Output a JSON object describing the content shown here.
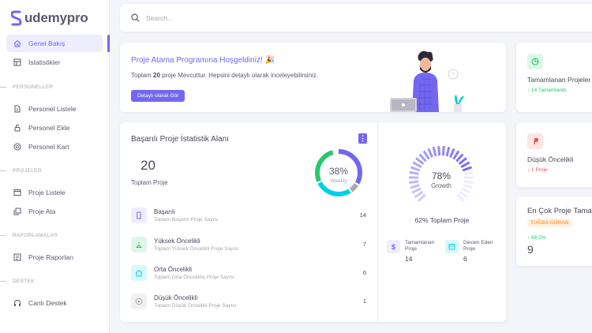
{
  "app": {
    "logo_text": "udemypro"
  },
  "sidebar": {
    "items": {
      "genel": "Genel Bakış",
      "istatistikler": "İstatistikler",
      "personel_listele": "Personel Listele",
      "personel_ekle": "Personel Ekle",
      "personel_kart": "Personel Kart",
      "proje_listele": "Proje Listele",
      "proje_ata": "Proje Ata",
      "proje_raporlari": "Proje Raporları",
      "canli_destek": "Canlı Destek"
    },
    "sections": {
      "personeller": "PERSONELLER",
      "projeler": "PROJELER",
      "raporlamalar": "RAPORLAMALAR",
      "destek": "DESTEK"
    }
  },
  "search": {
    "placeholder": "Search..."
  },
  "welcome": {
    "title": "Proje Atama Programına Hoşgeldiniz! 🎉",
    "text_prefix": "Toplam ",
    "count": "20",
    "text_suffix": " proje Mevcuttur. Hepsini detaylı olarak inceleyebilirsiniz.",
    "button": "Detaylı olarak Gör"
  },
  "right_cards": {
    "completed": {
      "title": "Tamamlanan Projeler",
      "sub": "↑ 14 Tamamlandı",
      "sub_color": "#28c76f"
    },
    "low_priority": {
      "title": "Düşük Öncelikli",
      "sub": "↓ 1 Proje",
      "sub_color": "#ea5455"
    },
    "top": {
      "title": "En Çok Proje Tamamlayan",
      "badge": "TUĞBA GÜRAN",
      "pct": "↑ 68.2%",
      "value": "9"
    }
  },
  "stats": {
    "title": "Başarılı Proje İstatistik Alanı",
    "menu": "⋮",
    "total_value": "20",
    "total_label": "Toplam Proje",
    "donut_value": "38%",
    "donut_label": "Weekly",
    "rows": [
      {
        "title": "Başarılı",
        "sub": "Toplam Başarılı Proje Sayısı",
        "value": "14"
      },
      {
        "title": "Yüksek Öncelikli",
        "sub": "Toplam Yüksek Öncelikli Proje Sayısı",
        "value": "7"
      },
      {
        "title": "Orta Öncelikli",
        "sub": "Toplam Orta Öncelikliş Proje Sayısı",
        "value": "6"
      },
      {
        "title": "Düşük Öncelikli",
        "sub": "Toplam Düşük Öncelikli Proje Sayısı",
        "value": "1"
      }
    ],
    "gauge_value": "78%",
    "gauge_label": "Growth",
    "gauge_fraction": 0.78,
    "total_pct": "62% Toplam Proje",
    "mini": [
      {
        "label": "Tamamlanan Proje",
        "value": "14"
      },
      {
        "label": "Devam Eden Proje",
        "value": "6"
      }
    ]
  },
  "colors": {
    "primary": "#7367f0",
    "success": "#28c76f",
    "danger": "#ea5455",
    "info": "#00cfe8",
    "warning": "#ff9f43"
  }
}
